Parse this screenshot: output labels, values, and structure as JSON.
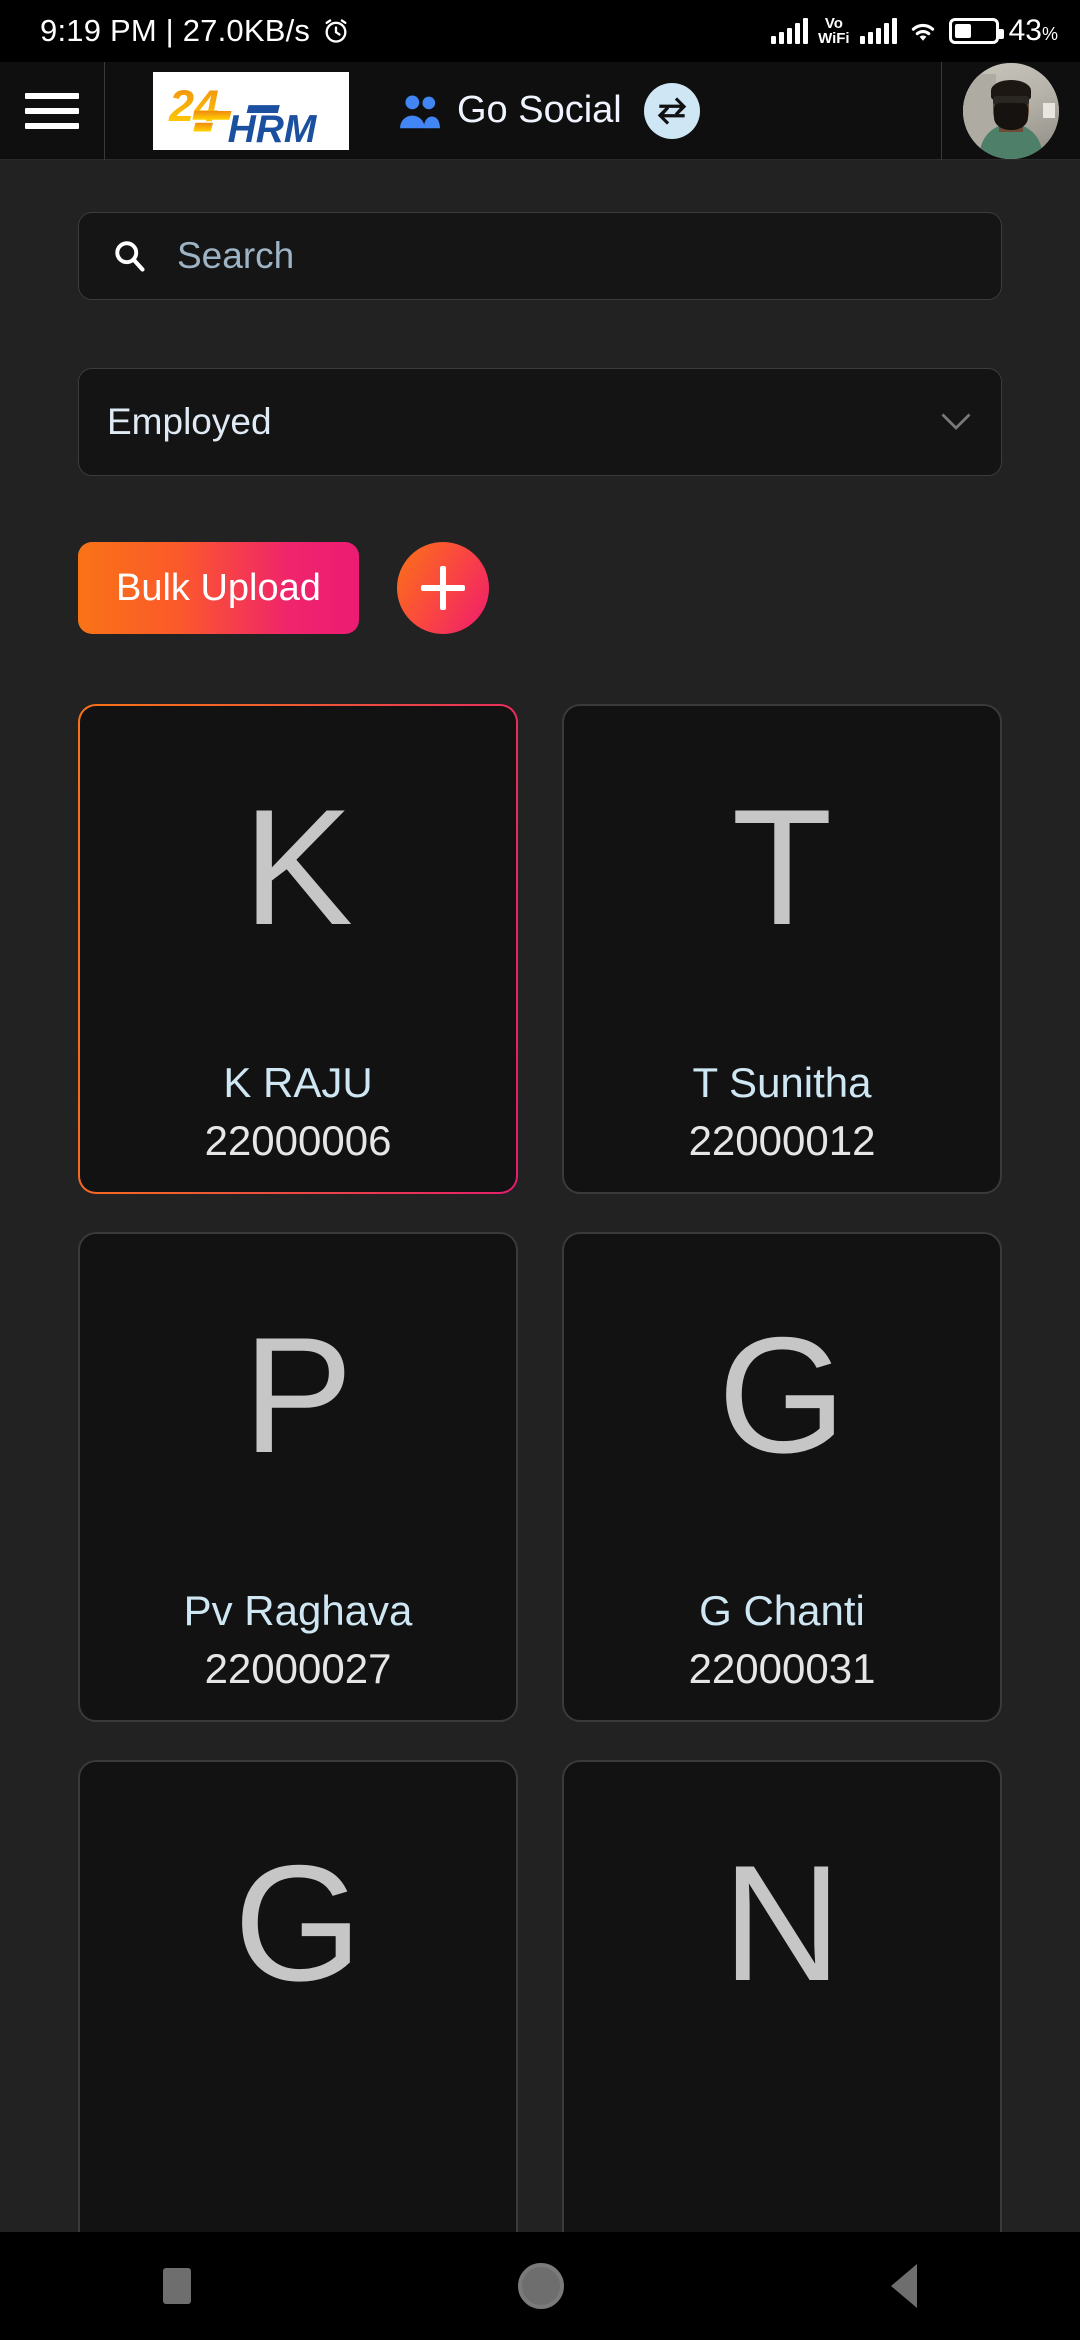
{
  "status_bar": {
    "clock": "9:19 PM | 27.0KB/s",
    "alarm_icon": "alarm-clock-icon",
    "signal_icon": "signal-bars-icon",
    "volte_line1": "Vo",
    "volte_line2": "WiFi",
    "signal2_icon": "signal-bars-icon",
    "wifi_icon": "wifi-icon",
    "battery_icon": "battery-icon",
    "battery_level": "43",
    "battery_unit": "%"
  },
  "header": {
    "menu_icon": "hamburger-menu-icon",
    "logo_text": "24HRM",
    "logo_digits": "24",
    "logo_word": "HRM",
    "go_social_label": "Go Social",
    "people_icon": "people-icon",
    "swap_icon": "swap-horizontal-icon",
    "avatar_name": "avatar"
  },
  "search": {
    "icon": "search-icon",
    "placeholder": "Search",
    "value": ""
  },
  "filter": {
    "selected": "Employed",
    "chevron_icon": "chevron-down-icon"
  },
  "actions": {
    "bulk_upload_label": "Bulk Upload",
    "add_icon": "plus-icon"
  },
  "employees": [
    {
      "initial": "K",
      "name": "K RAJU",
      "id": "22000006",
      "selected": true
    },
    {
      "initial": "T",
      "name": "T Sunitha",
      "id": "22000012",
      "selected": false
    },
    {
      "initial": "P",
      "name": "Pv Raghava",
      "id": "22000027",
      "selected": false
    },
    {
      "initial": "G",
      "name": "G Chanti",
      "id": "22000031",
      "selected": false
    },
    {
      "initial": "G",
      "name": "",
      "id": "",
      "selected": false
    },
    {
      "initial": "N",
      "name": "",
      "id": "",
      "selected": false
    }
  ],
  "nav_bar": {
    "recents_icon": "square-recents-icon",
    "home_icon": "circle-home-icon",
    "back_icon": "triangle-back-icon"
  },
  "colors": {
    "page_bg": "#222222",
    "card_bg": "#121212",
    "accent_start": "#f97316",
    "accent_end": "#ec1c74",
    "name_text": "#cfe6f3",
    "social_blue": "#4285f4"
  }
}
